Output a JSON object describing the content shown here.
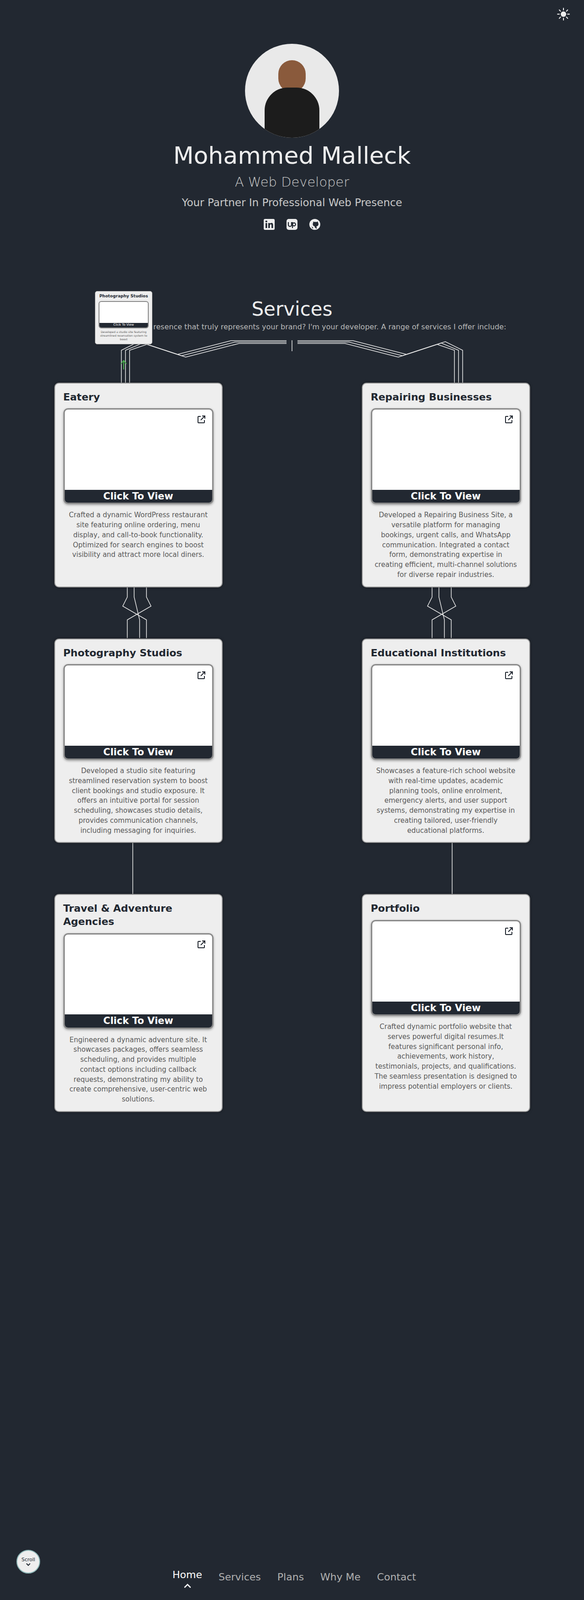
{
  "profile": {
    "name": "Mohammed Malleck",
    "role": "A Web Developer",
    "tagline": "Your Partner In Professional Web Presence"
  },
  "services": {
    "title": "Services",
    "subtitle": "resence that truly represents your brand? I'm your developer. A range of services I offer include:",
    "preview_card": {
      "title": "Photography Studios",
      "button": "Click To View",
      "description": "Developed a studio site featuring streamlined reservation system to boost"
    }
  },
  "cards": [
    {
      "title": "Eatery",
      "button": "Click To View",
      "description": "Crafted a dynamic WordPress restaurant site featuring online ordering, menu display, and call-to-book functionality. Optimized for search engines to boost visibility and attract more local diners."
    },
    {
      "title": "Repairing Businesses",
      "button": "Click To View",
      "description": "Developed a Repairing Business Site, a versatile platform for managing bookings, urgent calls, and WhatsApp communication. Integrated a contact form, demonstrating expertise in creating efficient, multi-channel solutions for diverse repair industries."
    },
    {
      "title": "Photography Studios",
      "button": "Click To View",
      "description": "Developed a studio site featuring streamlined reservation system to boost client bookings and studio exposure. It offers an intuitive portal for session scheduling, showcases studio details, provides communication channels, including messaging for inquiries."
    },
    {
      "title": "Educational Institutions",
      "button": "Click To View",
      "description": "Showcases a feature-rich school website with real-time updates, academic planning tools, online enrolment, emergency alerts, and user support systems, demonstrating my expertise in creating tailored, user-friendly educational platforms."
    },
    {
      "title": "Travel & Adventure Agencies",
      "button": "Click To View",
      "description": "Engineered a dynamic adventure site. It showcases packages, offers seamless scheduling, and provides multiple contact options including callback requests, demonstrating my ability to create comprehensive, user-centric web solutions."
    },
    {
      "title": "Portfolio",
      "button": "Click To View",
      "description": "Crafted dynamic portfolio website that serves powerful digital resumes.It features significant personal info, achievements, work history, testimonials, projects, and qualifications. The seamless presentation is designed to impress potential employers or clients."
    }
  ],
  "scroll_button": {
    "label": "Scroll"
  },
  "nav": [
    {
      "label": "Home",
      "selected": true
    },
    {
      "label": "Services",
      "selected": false
    },
    {
      "label": "Plans",
      "selected": false
    },
    {
      "label": "Why Me",
      "selected": false
    },
    {
      "label": "Contact",
      "selected": false
    }
  ]
}
